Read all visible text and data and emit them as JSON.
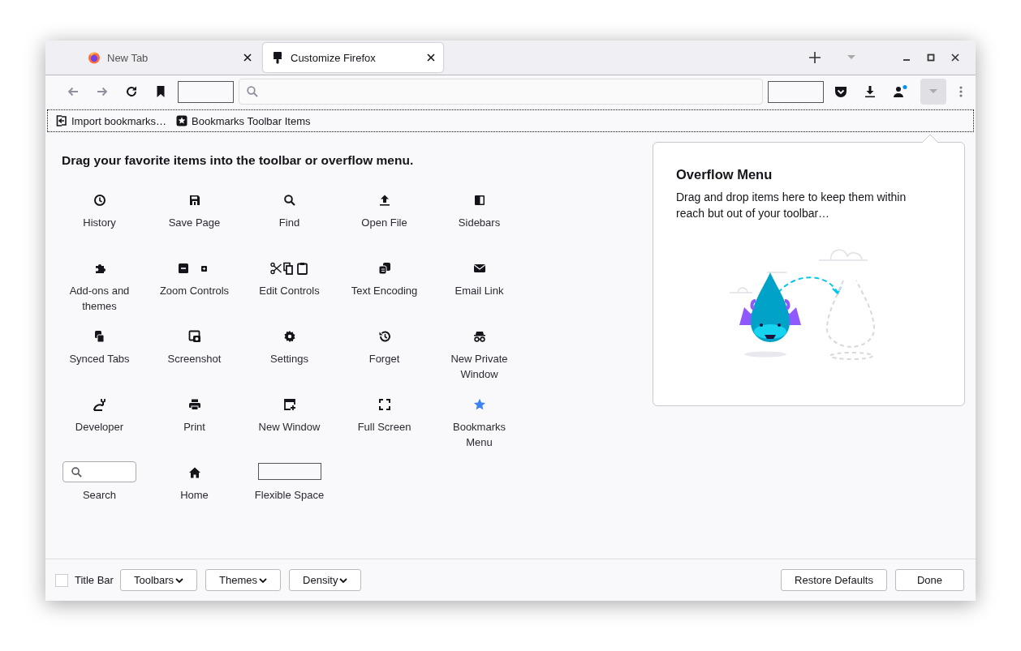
{
  "tabs": [
    {
      "label": "New Tab",
      "selected": false
    },
    {
      "label": "Customize Firefox",
      "selected": true
    }
  ],
  "navigation": {
    "back": {
      "disabled": true
    },
    "forward": {
      "disabled": true
    }
  },
  "bookmarks_toolbar": [
    {
      "label": "Import bookmarks…"
    },
    {
      "label": "Bookmarks Toolbar Items"
    }
  ],
  "heading": "Drag your favorite items into the toolbar or overflow menu.",
  "palette": [
    {
      "kind": "button",
      "label": "History"
    },
    {
      "kind": "button",
      "label": "Save Page"
    },
    {
      "kind": "button",
      "label": "Find"
    },
    {
      "kind": "button",
      "label": "Open File"
    },
    {
      "kind": "button",
      "label": "Sidebars"
    },
    {
      "kind": "button",
      "label": "Add-ons and themes"
    },
    {
      "kind": "button",
      "label": "Zoom Controls"
    },
    {
      "kind": "button",
      "label": "Edit Controls"
    },
    {
      "kind": "button",
      "label": "Text Encoding"
    },
    {
      "kind": "button",
      "label": "Email Link"
    },
    {
      "kind": "button",
      "label": "Synced Tabs"
    },
    {
      "kind": "button",
      "label": "Screenshot"
    },
    {
      "kind": "button",
      "label": "Settings"
    },
    {
      "kind": "button",
      "label": "Forget"
    },
    {
      "kind": "button",
      "label": "New Private Window"
    },
    {
      "kind": "button",
      "label": "Developer"
    },
    {
      "kind": "button",
      "label": "Print"
    },
    {
      "kind": "button",
      "label": "New Window"
    },
    {
      "kind": "button",
      "label": "Full Screen"
    },
    {
      "kind": "button",
      "label": "Bookmarks Menu"
    },
    {
      "kind": "search",
      "label": "Search"
    },
    {
      "kind": "button",
      "label": "Home"
    },
    {
      "kind": "spacer",
      "label": "Flexible Space"
    }
  ],
  "overflow_panel": {
    "title": "Overflow Menu",
    "text": "Drag and drop items here to keep them within reach but out of your toolbar…"
  },
  "footer": {
    "title_bar": {
      "label": "Title Bar",
      "checked": false
    },
    "menus": [
      "Toolbars",
      "Themes",
      "Density"
    ],
    "buttons": [
      "Restore Defaults",
      "Done"
    ]
  }
}
